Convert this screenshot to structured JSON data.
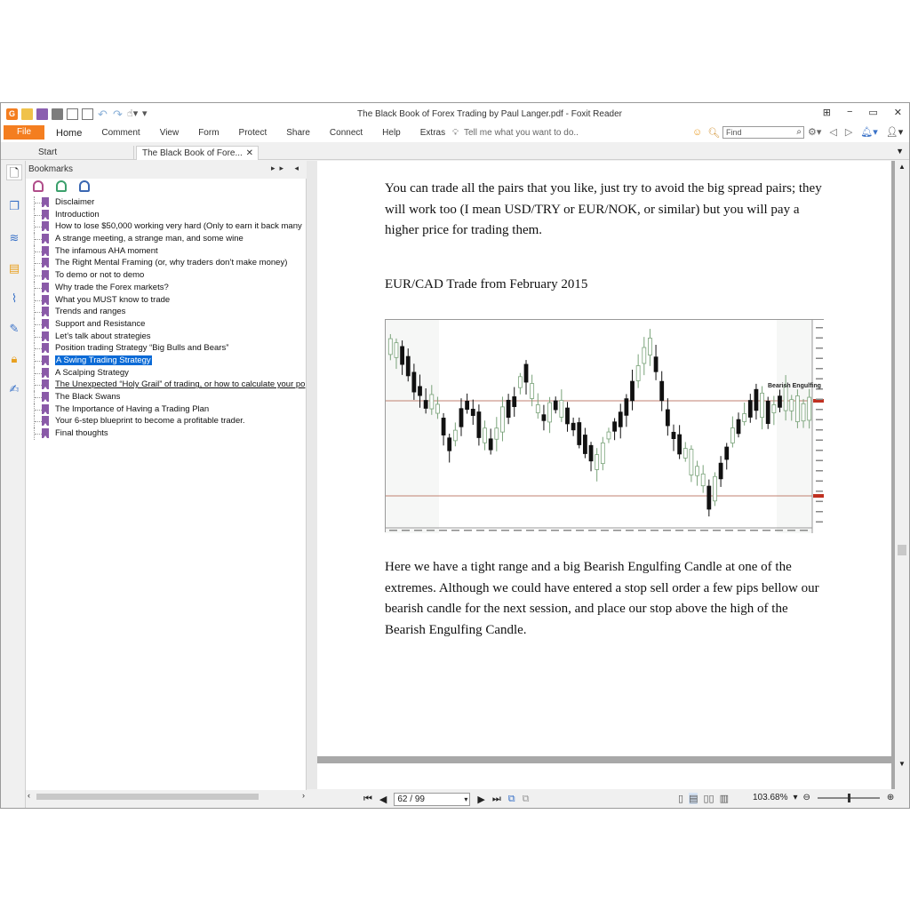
{
  "window": {
    "title": "The Black Book of Forex Trading by Paul Langer.pdf - Foxit Reader",
    "controls": [
      "⊞",
      "−",
      "▭",
      "✕"
    ]
  },
  "ribbon": {
    "file_label": "File",
    "menu": [
      "Home",
      "Comment",
      "View",
      "Form",
      "Protect",
      "Share",
      "Connect",
      "Help",
      "Extras"
    ],
    "tellme": "Tell me what you want to do..",
    "find_placeholder": "Find"
  },
  "tabs": {
    "start": "Start",
    "document": "The Black Book of Fore..."
  },
  "bookmarks": {
    "header": "Bookmarks",
    "items": [
      "Disclaimer",
      "Introduction",
      "How to lose $50,000 working very hard (Only to earn it back many",
      "A strange meeting, a strange man, and some wine",
      "The infamous AHA moment",
      "The Right Mental Framing (or, why traders don’t make money)",
      "To demo or not to demo",
      "Why trade the Forex markets?",
      "What you MUST know to trade",
      "Trends and ranges",
      "Support and Resistance",
      "Let’s talk about strategies",
      "Position trading Strategy “Big Bulls and Bears”",
      "A Swing Trading Strategy",
      "A Scalping Strategy",
      "The Unexpected “Holy Grail” of trading, or how to calculate your po",
      "The Black Swans",
      "The Importance of Having a Trading Plan",
      "Your 6-step blueprint to become a profitable trader.",
      "Final thoughts"
    ],
    "selected_index": 13
  },
  "document": {
    "para1": "You can trade all the pairs that you like, just try to avoid the big spread pairs; they will work too (I mean USD/TRY or EUR/NOK, or similar) but you will pay a higher price for trading them.",
    "chart_heading": "EUR/CAD Trade from February 2015",
    "chart_annotation": "Bearish Engulfing",
    "para2": "Here we have a tight range and a big Bearish Engulfing Candle at one of the extremes. Although we could have entered a stop sell order a few pips bellow our bearish candle for the next session, and place our stop above the high of the Bearish Engulfing Candle."
  },
  "statusbar": {
    "page_indicator": "62 / 99",
    "zoom": "103.68%"
  },
  "colors": {
    "accent": "#f47e20",
    "selection": "#0a6ad6",
    "bookmark_flag": "#8a5aa8"
  }
}
